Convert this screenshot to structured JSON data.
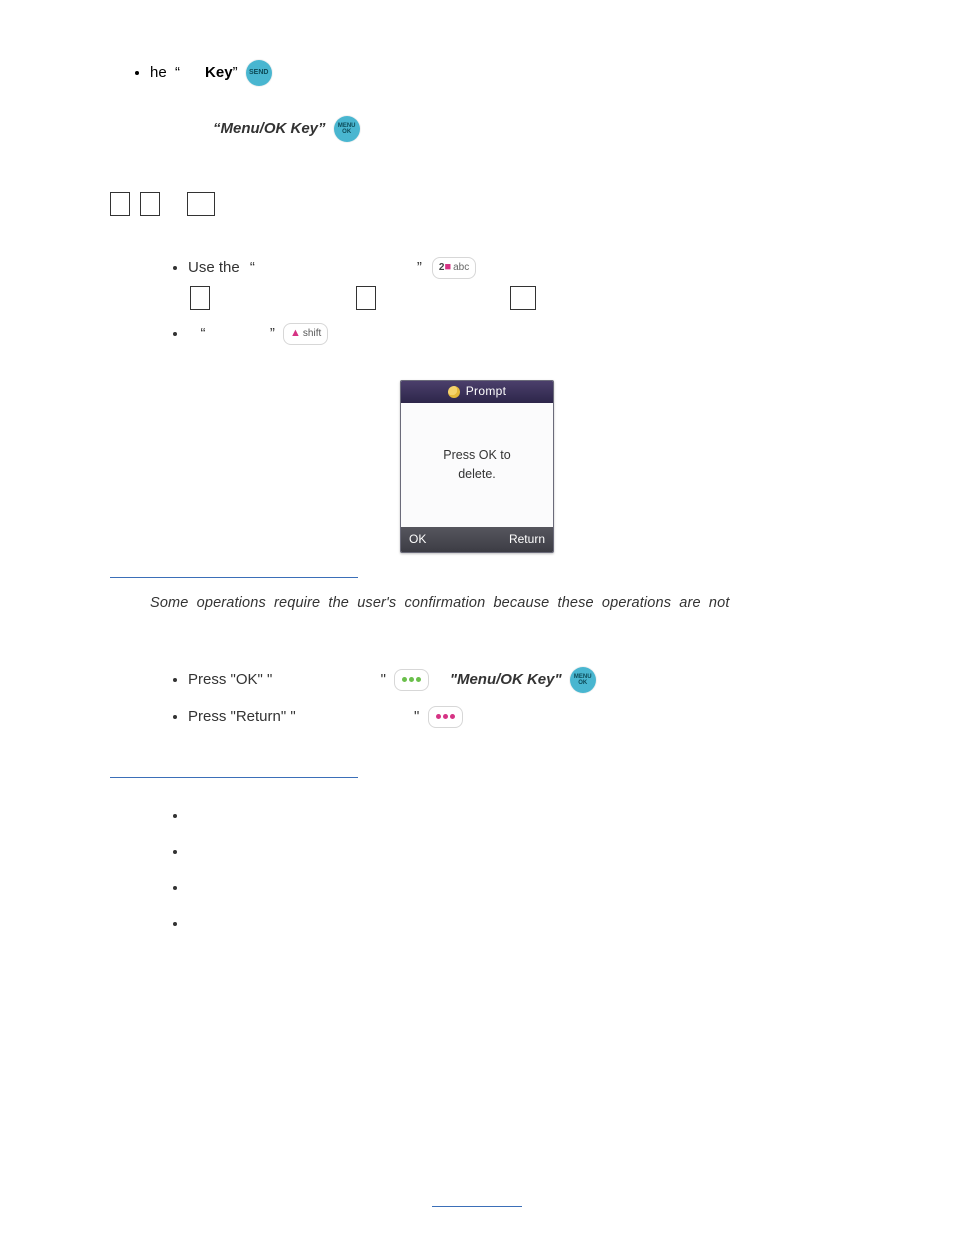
{
  "line1": {
    "text_before_quote": "he",
    "key_bold": "Key",
    "send_badge": "SEND"
  },
  "menuok": {
    "label": "Menu/OK Key",
    "badge": "MENU OK"
  },
  "list2": {
    "use_the": "Use the",
    "key2_pill_label": "2",
    "key2_pill_right": "abc",
    "shift_label": "shift"
  },
  "device": {
    "title": "Prompt",
    "body_line1": "Press OK to",
    "body_line2": "delete.",
    "soft_left": "OK",
    "soft_right": "Return"
  },
  "note": "Some operations require the user's confirmation because these operations are not",
  "okreturn": {
    "press_ok": "Press \"OK\" \"",
    "press_return": "Press \"Return\" \"",
    "end_quote": "\"",
    "menuok_label": "\"Menu/OK Key\"",
    "menuok_badge": "MENU OK"
  }
}
